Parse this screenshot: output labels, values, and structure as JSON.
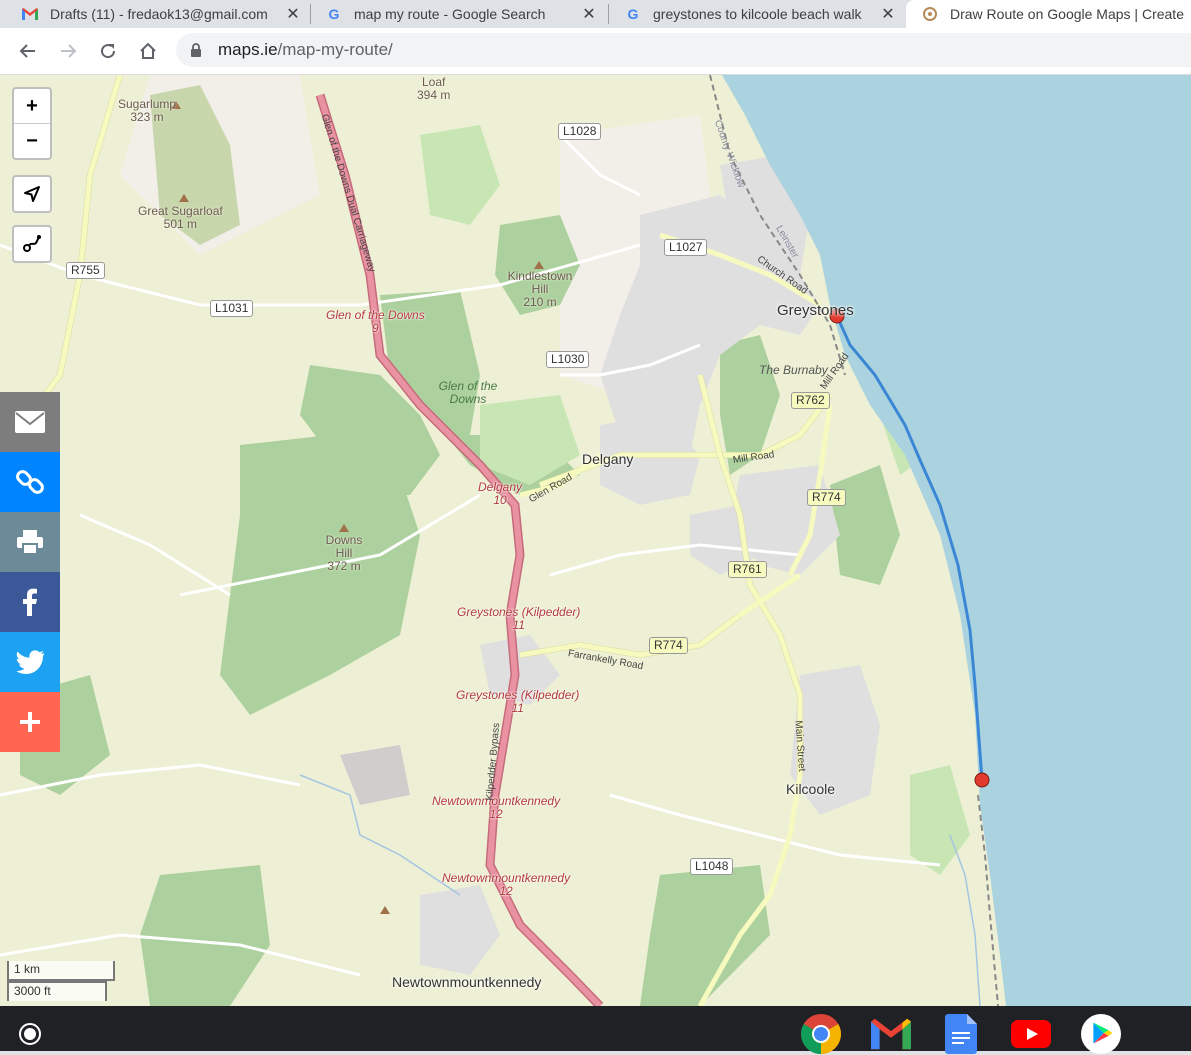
{
  "browser": {
    "tabs": [
      {
        "title": "Drafts (11) - fredaok13@gmail.com",
        "favicon": "gmail-icon"
      },
      {
        "title": "map my route - Google Search",
        "favicon": "google-icon"
      },
      {
        "title": "greystones to kilcoole beach walk",
        "favicon": "google-icon"
      },
      {
        "title": "Draw Route on Google Maps | Create",
        "favicon": "maps-ie-icon",
        "active": true
      }
    ],
    "url_host": "maps.ie",
    "url_path": "/map-my-route/"
  },
  "map": {
    "controls": {
      "zoom_in": "+",
      "zoom_out": "−"
    },
    "colors": {
      "sea": "#aad3df",
      "land": "#f2efe9",
      "farmland": "#eef0d5",
      "forest": "#add19e",
      "urban": "#e0dfdf",
      "motorway": "#e892a2",
      "primary": "#fcd6a4",
      "secondary": "#f7fabf",
      "route": "#3b87d6",
      "marker": "#e03b2e"
    },
    "places": {
      "greystones": "Greystones",
      "delgany": "Delgany",
      "kilcoole": "Kilcoole",
      "newtownmountkennedy": "Newtownmountkennedy",
      "the_burnaby": "The Burnaby"
    },
    "hills": {
      "sugarlump": "Sugarlump",
      "sugarlump_height": "323 m",
      "great_sugarloaf": "Great Sugarloaf",
      "great_sugarloaf_height": "501 m",
      "kindlestown": "Kindlestown Hill",
      "kindlestown_height": "210 m",
      "downs": "Downs Hill",
      "downs_height": "372 m",
      "loaf": "Loaf",
      "loaf_height": "394 m"
    },
    "woods": {
      "glen_of_the_downs": "Glen of the Downs"
    },
    "junctions": [
      {
        "name": "Glen of the Downs",
        "number": "9"
      },
      {
        "name": "Delgany",
        "number": "10"
      },
      {
        "name": "Greystones (Kilpedder)",
        "number": "11"
      },
      {
        "name": "Greystones (Kilpedder)",
        "number": "11"
      },
      {
        "name": "Newtownmountkennedy",
        "number": "12"
      },
      {
        "name": "Newtownmountkennedy",
        "number": "12"
      }
    ],
    "road_refs": {
      "r755": "R755",
      "l1031": "L1031",
      "l1028": "L1028",
      "l1027": "L1027",
      "l1030": "L1030",
      "r762": "R762",
      "r774a": "R774",
      "r774b": "R774",
      "r761": "R761",
      "l1048": "L1048"
    },
    "street_names": {
      "glen_dual": "Glen of the Downs Dual Carriageway",
      "church_road": "Church Road",
      "mill_road": "Mill Road",
      "mill_road2": "Mill Road",
      "glen_road": "Glen Road",
      "farrankelly": "Farrankelly Road",
      "main_street": "Main Street",
      "kilpedder_bypass": "Kilpedder Bypass",
      "county_wicklow": "County Wicklow",
      "leinster": "Leinster"
    },
    "scale": {
      "metric": "1 km",
      "imperial": "3000 ft"
    }
  },
  "share_bar": {
    "items": [
      "email-icon",
      "link-icon",
      "print-icon",
      "facebook-icon",
      "twitter-icon",
      "plus-icon"
    ],
    "colors": [
      "#7d7d7d",
      "#0084ff",
      "#6d8a99",
      "#3b5998",
      "#1da1f2",
      "#ff6550"
    ]
  },
  "shelf": {
    "apps": [
      "chrome-icon",
      "gmail-icon",
      "docs-icon",
      "youtube-icon",
      "play-store-icon"
    ]
  }
}
